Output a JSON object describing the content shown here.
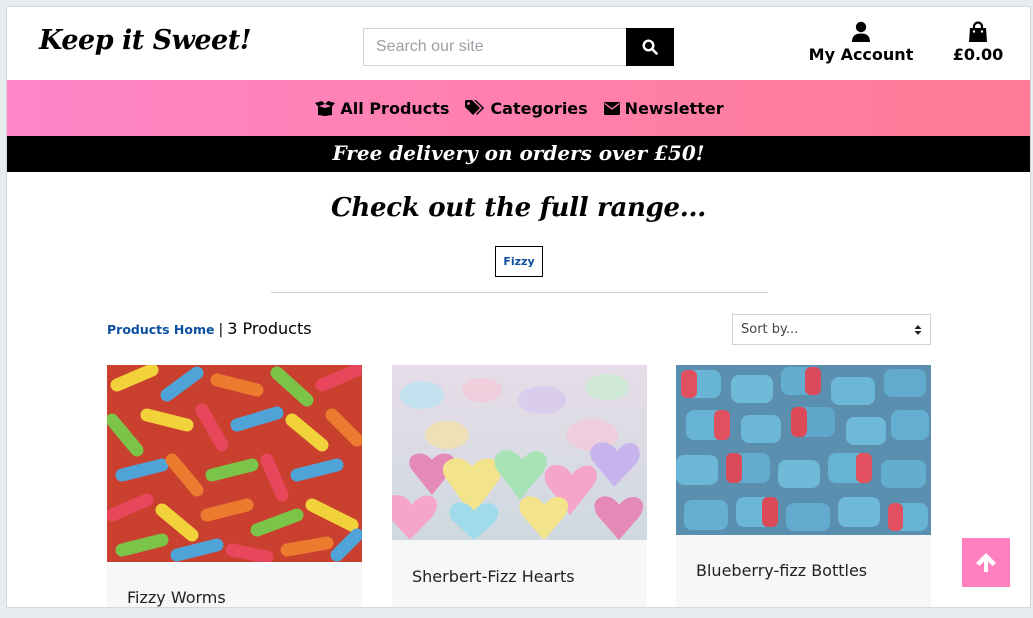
{
  "header": {
    "logo": "Keep it Sweet!",
    "search": {
      "placeholder": "Search our site",
      "value": ""
    },
    "search_icon": "search-icon",
    "account": {
      "label": "My Account",
      "icon": "user-icon"
    },
    "cart": {
      "label": "£0.00",
      "icon": "shopping-bag-icon"
    }
  },
  "nav": {
    "items": [
      {
        "label": "All Products",
        "icon": "box-open-icon"
      },
      {
        "label": "Categories",
        "icon": "tags-icon"
      },
      {
        "label": "Newsletter",
        "icon": "envelope-icon"
      }
    ]
  },
  "promo": {
    "text": "Free delivery on orders over £50!"
  },
  "main": {
    "heading": "Check out the full range...",
    "category_badge": "Fizzy",
    "breadcrumb": {
      "home": "Products Home",
      "separator": "|",
      "count": "3 Products"
    },
    "sort": {
      "selected": "Sort by..."
    }
  },
  "products": [
    {
      "name": "Fizzy Worms"
    },
    {
      "name": "Sherbert-Fizz Hearts"
    },
    {
      "name": "Blueberry-fizz Bottles"
    }
  ],
  "colors": {
    "nav_gradient_start": "#ff85c8",
    "nav_gradient_end": "#ff7b95",
    "promo_bg": "#000000",
    "link": "#0d4fa0",
    "back_to_top": "#ff7fbf"
  },
  "back_to_top_icon": "arrow-up-icon"
}
